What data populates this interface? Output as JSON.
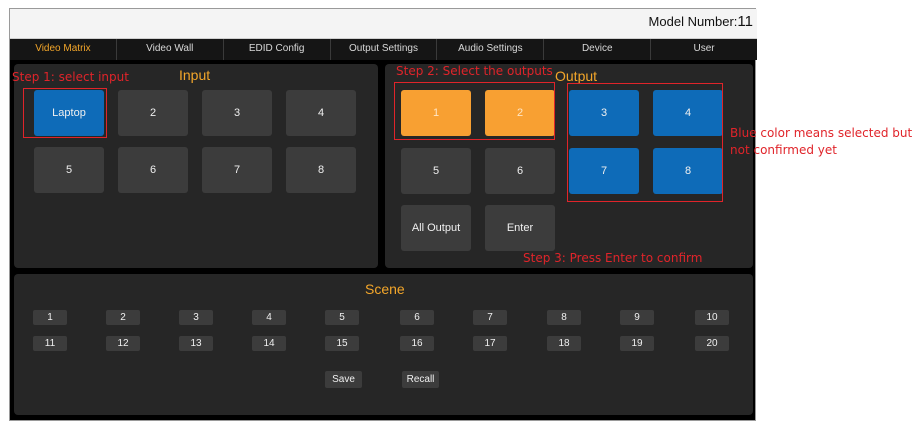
{
  "header": {
    "model_label": "Model Number:",
    "model_number": "11"
  },
  "nav": {
    "items": [
      {
        "label": "Video Matrix"
      },
      {
        "label": "Video Wall"
      },
      {
        "label": "EDID Config"
      },
      {
        "label": "Output Settings"
      },
      {
        "label": "Audio Settings"
      },
      {
        "label": "Device"
      },
      {
        "label": "User"
      }
    ],
    "active_color": "#f3a62a"
  },
  "input": {
    "title": "Input",
    "buttons": [
      "Laptop",
      "2",
      "3",
      "4",
      "5",
      "6",
      "7",
      "8"
    ],
    "selected": "Laptop"
  },
  "output": {
    "title": "Output",
    "buttons": [
      "1",
      "2",
      "3",
      "4",
      "5",
      "6",
      "7",
      "8"
    ],
    "confirmed": [
      "1",
      "2"
    ],
    "selected_unconfirmed": [
      "3",
      "4",
      "7",
      "8"
    ],
    "all_output_label": "All Output",
    "enter_label": "Enter"
  },
  "scene": {
    "title": "Scene",
    "buttons": [
      "1",
      "2",
      "3",
      "4",
      "5",
      "6",
      "7",
      "8",
      "9",
      "10",
      "11",
      "12",
      "13",
      "14",
      "15",
      "16",
      "17",
      "18",
      "19",
      "20"
    ],
    "save_label": "Save",
    "recall_label": "Recall"
  },
  "annotations": {
    "step1": "Step 1: select input",
    "step2": "Step 2: Select the outputs",
    "step3": "Step 3: Press Enter to confirm",
    "blue_note_line1": "Blue color means selected but",
    "blue_note_line2": "not confirmed yet"
  },
  "colors": {
    "selected_blue": "#0e6bb8",
    "confirmed_orange": "#f8a032",
    "annotation_red": "#e0242a",
    "panel_bg": "#262626",
    "button_bg": "#3c3c3c"
  }
}
